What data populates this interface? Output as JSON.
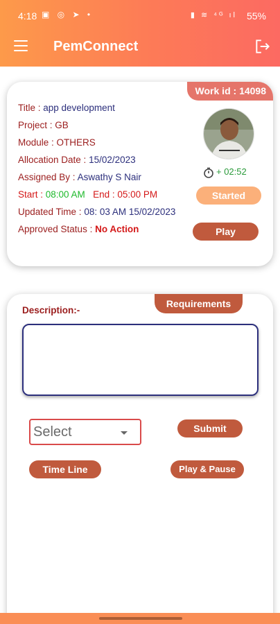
{
  "status_bar": {
    "time": "4:18",
    "battery": "55%"
  },
  "appbar": {
    "title": "PemConnect"
  },
  "task": {
    "work_id": "Work id : 14098",
    "title_label": "Title : ",
    "title": "app development",
    "project_label": "Project : ",
    "project": "GB",
    "module_label": "Module : ",
    "module": "OTHERS",
    "allocation_label": "Allocation Date : ",
    "allocation_date": "15/02/2023",
    "assigned_label": "Assigned By : ",
    "assigned_by": "Aswathy S Nair",
    "start_label": "Start : ",
    "start": "08:00 AM",
    "end_label": "End : ",
    "end": "05:00 PM",
    "updated_label": "Updated Time : ",
    "updated_time": "08: 03 AM 15/02/2023",
    "approved_label": "Approved Status : ",
    "approved_status": "No Action",
    "timer": "+ 02:52",
    "started_label": "Started",
    "play_label": "Play"
  },
  "requirements": {
    "tab_label": "Requirements",
    "description_label": "Description:-",
    "description_value": "",
    "select_value": "Select",
    "submit_label": "Submit",
    "timeline_label": "Time Line",
    "play_pause_label": "Play & Pause"
  },
  "colors": {
    "accent": "#c05a3d",
    "gradient_start": "#fd9a4a",
    "gradient_end": "#fc6a62"
  }
}
